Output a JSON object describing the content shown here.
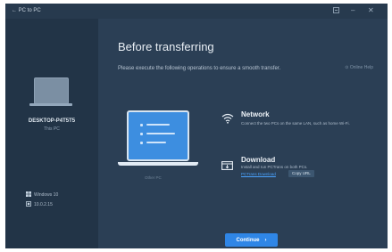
{
  "window": {
    "title": "PC to PC"
  },
  "sidebar": {
    "pc_name": "DESKTOP-P4T5T5",
    "pc_sub": "This PC",
    "os": "Windows 10",
    "version": "10.0.2.15"
  },
  "main": {
    "title": "Before transferring",
    "subtitle": "Please execute the following operations to ensure a smooth transfer.",
    "help": "Online Help",
    "other_pc": "Other PC"
  },
  "steps": [
    {
      "title": "Network",
      "text": "Connect the two PCs on the same LAN, such as home Wi-Fi.",
      "icon": "wifi-icon"
    },
    {
      "title": "Download",
      "text": "Install and run PCTrans on both PCs.",
      "icon": "download-icon",
      "link": "PCTrans Download",
      "button": "Copy URL"
    }
  ],
  "continue_label": "Continue",
  "colors": {
    "accent": "#2f86e6",
    "link": "#4aa3ff",
    "sidebar_bg": "#223447",
    "main_bg": "#2b3f55"
  }
}
